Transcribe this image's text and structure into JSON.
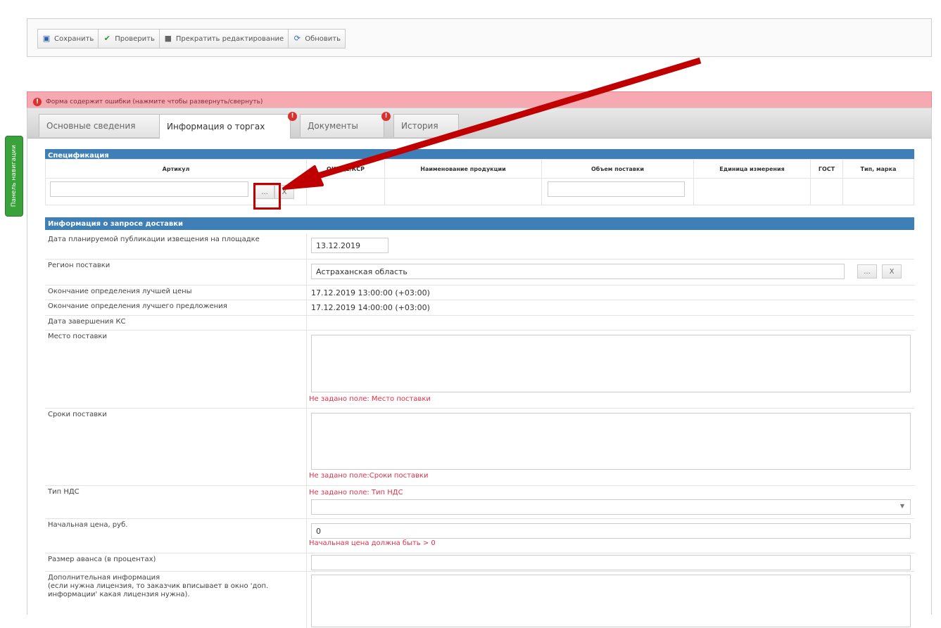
{
  "sidenav": {
    "label": "Панель навигации"
  },
  "toolbar": {
    "save": "Сохранить",
    "check": "Проверить",
    "stop_edit": "Прекратить редактирование",
    "refresh": "Обновить"
  },
  "error_banner": {
    "text": "Форма содержит ошибки (нажмите чтобы развернуть/свернуть)"
  },
  "tabs": [
    {
      "label": "Основные сведения",
      "error": false
    },
    {
      "label": "Информация о торгах",
      "error": true
    },
    {
      "label": "Документы",
      "error": true
    },
    {
      "label": "История",
      "error": false
    }
  ],
  "spec": {
    "title": "Спецификация",
    "columns": [
      "Артикул",
      "ОКПД2/КСР",
      "Наименование продукции",
      "Объем поставки",
      "Единица измерения",
      "ГОСТ",
      "Тип, марка"
    ],
    "browse_label": "...",
    "clear_label": "X"
  },
  "delivery": {
    "title": "Информация о запросе доставки",
    "pub_date_label": "Дата планируемой публикации извещения на площадке",
    "pub_date_value": "13.12.2019",
    "region_label": "Регион поставки",
    "region_value": "Астраханская область",
    "best_price_end_label": "Окончание определения лучшей цены",
    "best_price_end_value": "17.12.2019 13:00:00 (+03:00)",
    "best_offer_end_label": "Окончание определения лучшего предложения",
    "best_offer_end_value": "17.12.2019 14:00:00 (+03:00)",
    "ks_end_label": "Дата завершения КС",
    "ks_end_value": "",
    "place_label": "Место поставки",
    "place_error": "Не задано поле: Место поставки",
    "terms_label": "Сроки поставки",
    "terms_error": "Не задано поле:Сроки поставки",
    "vat_label": "Тип НДС",
    "vat_error": "Не задано поле: Тип НДС",
    "price_label": "Начальная цена, руб.",
    "price_value": "0",
    "price_error": "Начальная цена должна быть > 0",
    "advance_label": "Размер аванса (в процентах)",
    "extra_label": "Дополнительная информация",
    "extra_hint": "(если нужна лицензия, то заказчик вписывает в окно 'доп. информации' какая лицензия нужна)."
  },
  "colors": {
    "section": "#3d7fb6",
    "error_bg": "#f7a9b2",
    "error_text": "#e0304a",
    "callout": "#c00000",
    "nav": "#3aa23a"
  }
}
